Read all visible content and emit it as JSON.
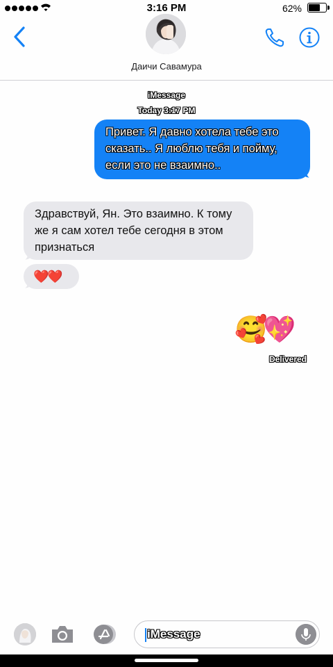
{
  "status_bar": {
    "time": "3:16 PM",
    "battery_percent": "62%",
    "battery_level": 0.62,
    "signal_bars": 5,
    "icons": [
      "signal-dots-icon",
      "wifi-icon",
      "battery-icon"
    ]
  },
  "header": {
    "contact_name": "Даичи Савамура",
    "icons": [
      "back-chevron-icon",
      "phone-icon",
      "info-icon"
    ]
  },
  "conversation": {
    "service_label": "iMessage",
    "timestamp": "Today 3:17 PM",
    "messages": [
      {
        "direction": "outgoing",
        "text": "Привет. Я давно хотела тебе это сказать.. Я люблю тебя и пойму, если это не взаимно.."
      },
      {
        "direction": "incoming",
        "text": "Здравствуй, Ян. Это взаимно. К тому же я сам хотел тебе сегодня в этом признаться"
      },
      {
        "direction": "incoming",
        "text": "❤️❤️"
      },
      {
        "direction": "outgoing",
        "text": "🥰💖"
      }
    ],
    "delivered_label": "Delivered"
  },
  "input_bar": {
    "placeholder": "iMessage",
    "icons": [
      "contact-avatar",
      "camera-icon",
      "app-store-icon",
      "microphone-icon"
    ]
  },
  "colors": {
    "accent": "#1482f6",
    "outgoing_bubble": "#1482f6",
    "incoming_bubble": "#e8e8ec",
    "background": "#fefefe"
  }
}
